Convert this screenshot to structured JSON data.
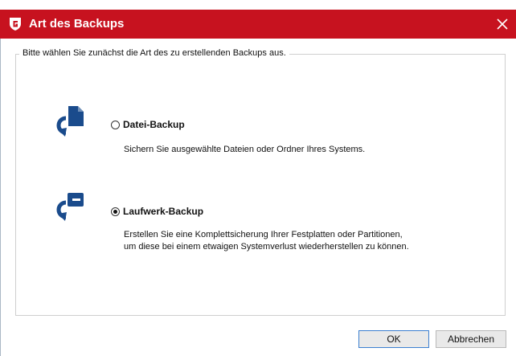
{
  "window": {
    "title": "Art des Backups",
    "brand_color": "#c7121f"
  },
  "group": {
    "caption": "Bitte wählen Sie zunächst die Art des zu erstellenden Backups aus."
  },
  "options": [
    {
      "label": "Datei-Backup",
      "description_lines": [
        "Sichern Sie ausgewählte Dateien oder Ordner Ihres Systems."
      ],
      "selected": false,
      "icon": "file-backup-icon"
    },
    {
      "label": "Laufwerk-Backup",
      "description_lines": [
        "Erstellen Sie eine Komplettsicherung Ihrer Festplatten oder Partitionen,",
        "um diese bei einem etwaigen Systemverlust wiederherstellen zu können."
      ],
      "selected": true,
      "icon": "drive-backup-icon"
    }
  ],
  "buttons": {
    "ok": "OK",
    "cancel": "Abbrechen"
  },
  "icons": {
    "accent": "#1a4b8c"
  }
}
